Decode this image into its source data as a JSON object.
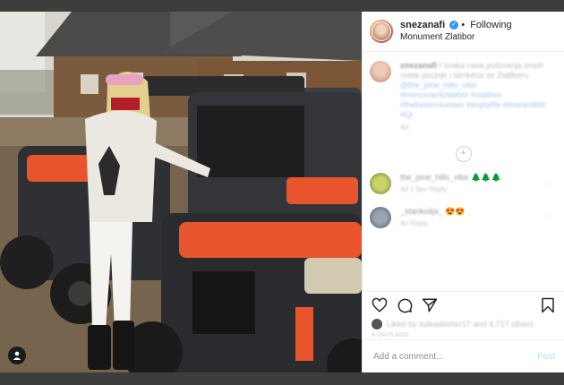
{
  "post": {
    "username": "snezanafi",
    "verified_mark": "✓",
    "follow_separator": "•",
    "follow_label": "Following",
    "location": "Monument Zlatibor"
  },
  "caption": {
    "username": "snezanafi",
    "text": "I svaka nasa putovanja smoh svete pocinje i tamkece se Zlatiboru",
    "mention": "@the_pine_hills_vibe",
    "tags": "#monumentzlatibor #zlatibor #thebestmountain #enjoylife #loveandlife #Qi",
    "meta": "4d",
    "more_symbol": "+"
  },
  "comments": [
    {
      "username": "the_pine_hills_vibe",
      "text": "🌲🌲🌲",
      "meta_age": "4d",
      "meta_likes": "1 like",
      "meta_reply": "Reply"
    },
    {
      "username": "_stankolija_",
      "text": "😍😍",
      "meta_age": "4d",
      "meta_likes": "",
      "meta_reply": "Reply"
    }
  ],
  "likes": {
    "text": "Liked by svikasboher17 and 4,717 others"
  },
  "date": {
    "text": "4 DAYS AGO"
  },
  "add_comment": {
    "placeholder": "Add a comment...",
    "post_label": "Post"
  },
  "icons": [
    "heart-icon",
    "comment-icon",
    "share-icon",
    "bookmark-icon",
    "person-tag-icon"
  ],
  "colors": {
    "verified": "#3897f0",
    "post_disabled": "#b2dffc",
    "atv_orange": "#e8542c"
  }
}
